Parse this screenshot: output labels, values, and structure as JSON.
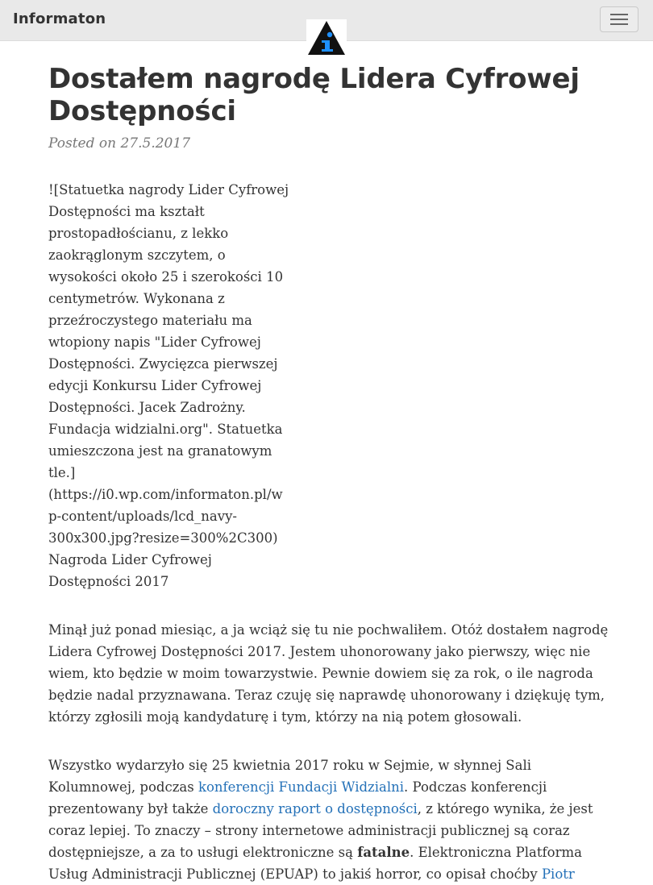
{
  "navbar": {
    "brand": "Informaton",
    "logo_icon": "information-triangle-icon",
    "menu_icon": "hamburger-menu-icon"
  },
  "post": {
    "title": "Dostałem nagrodę Lidera Cyfrowej Dostępności",
    "posted_prefix": "Posted on",
    "date": "27.5.2017",
    "image_alt_text": "![Statuetka nagrody Lider Cyfrowej Dostępności ma kształt prostopadłościanu, z lekko zaokrąglonym szczytem, o wysokości około 25 i szerokości 10 centymetrów. Wykonana z przeźroczystego materiału ma wtopiony napis \"Lider Cyfrowej Dostępności. Zwycięzca pierwszej edycji Konkursu Lider Cyfrowej Dostępności. Jacek Zadrożny. Fundacja widzialni.org\". Statuetka umieszczona jest na granatowym tle.](https://i0.wp.com/informaton.pl/wp-content/uploads/lcd_navy-300x300.jpg?resize=300%2C300) Nagroda Lider Cyfrowej Dostępności 2017",
    "paragraph1": "Minął już ponad miesiąc, a ja wciąż się tu nie pochwaliłem. Otóż dostałem nagrodę Lidera Cyfrowej Dostępności 2017. Jestem uhonorowany jako pierwszy, więc nie wiem, kto będzie w moim towarzystwie. Pewnie dowiem się za rok, o ile nagroda będzie nadal przyznawana. Teraz czuję się naprawdę uhonorowany i dziękuję tym, którzy zgłosili moją kandydaturę i tym, którzy na nią potem głosowali.",
    "paragraph2": {
      "t1": "Wszystko wydarzyło się 25 kwietnia 2017 roku w Sejmie, w słynnej Sali Kolumnowej, podczas ",
      "link1": "konferencji Fundacji Widzialni",
      "t2": ". Podczas konferencji prezentowany był także ",
      "link2": "doroczny raport o dostępności",
      "t3": ", z którego wynika, że jest coraz lepiej. To znaczy – strony internetowe administracji publicznej są coraz dostępniejsze, a za to usługi elektroniczne są ",
      "bold": "fatalne",
      "t4": ". Elektroniczna Platforma Usług Administracji Publicznej (EPUAP) to jakiś horror, co opisał choćby ",
      "link3": "Piotr"
    }
  },
  "colors": {
    "navbar_bg": "#e9e9e9",
    "text": "#333333",
    "meta": "#777777",
    "link": "#2471b8",
    "logo_blue": "#1e90ff"
  }
}
